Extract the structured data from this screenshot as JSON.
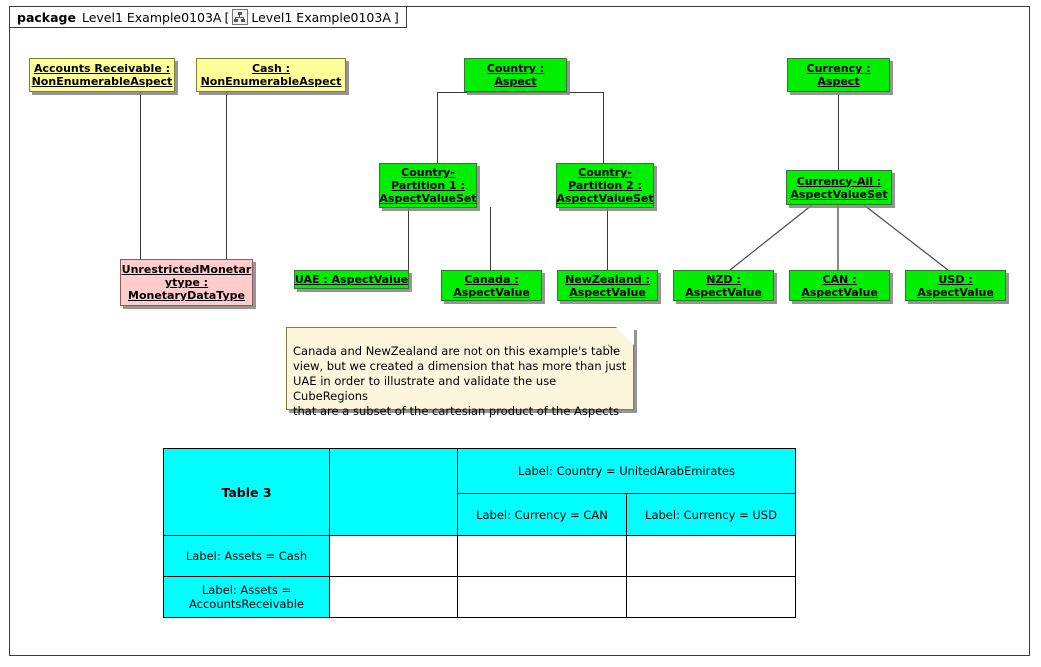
{
  "package": {
    "keyword": "package",
    "name": "Level1 Example0103A",
    "open_bracket": "[",
    "close_bracket": "]",
    "diagram_name": "Level1 Example0103A",
    "icon": "diagram-icon"
  },
  "colors": {
    "aspect_green": "#00ee00",
    "non_enumerable_yellow": "#ffff99",
    "data_type_pink": "#ffcccc",
    "note_yellow": "#fdf6dd",
    "table_header_cyan": "#00ffff",
    "line": "#3a3a3a"
  },
  "nodes": {
    "accounts_receivable": {
      "line1": "Accounts Receivable :",
      "line2": "NonEnumerableAspect"
    },
    "cash": {
      "line1": "Cash :",
      "line2": "NonEnumerableAspect"
    },
    "country": {
      "line1": "Country :",
      "line2": "Aspect"
    },
    "currency": {
      "line1": "Currency :",
      "line2": "Aspect"
    },
    "country_partition_1": {
      "line1": "Country-",
      "line2": "Partition 1 :",
      "line3": "AspectValueSet"
    },
    "country_partition_2": {
      "line1": "Country-",
      "line2": "Partition 2 :",
      "line3": "AspectValueSet"
    },
    "currency_all": {
      "line1": "Currency-All :",
      "line2": "AspectValueSet"
    },
    "unrestricted_monetary": {
      "line1": "UnrestrictedMonetar",
      "line2": "ytype :",
      "line3": "MonetaryDataType"
    },
    "uae": {
      "line1": "UAE : AspectValue"
    },
    "canada": {
      "line1": "Canada :",
      "line2": "AspectValue"
    },
    "newzealand": {
      "line1": "NewZealand :",
      "line2": "AspectValue"
    },
    "nzd": {
      "line1": "NZD :",
      "line2": "AspectValue"
    },
    "can": {
      "line1": "CAN :",
      "line2": "AspectValue"
    },
    "usd": {
      "line1": "USD :",
      "line2": "AspectValue"
    }
  },
  "note": {
    "text": "Canada and NewZealand are not on this example's table\nview, but we created a dimension that has more than just\nUAE in order to illustrate and validate the use CubeRegions\nthat are a subset of the cartesian product of the Aspects"
  },
  "table": {
    "title": "Table 3",
    "country_header": "Label: Country = UnitedArabEmirates",
    "currency_headers": [
      "Label: Currency = CAN",
      "Label: Currency = USD"
    ],
    "row_headers": [
      "Label: Assets = Cash",
      "Label: Assets = AccountsReceivable"
    ],
    "cells": [
      [
        "",
        "",
        ""
      ],
      [
        "",
        "",
        ""
      ]
    ]
  }
}
